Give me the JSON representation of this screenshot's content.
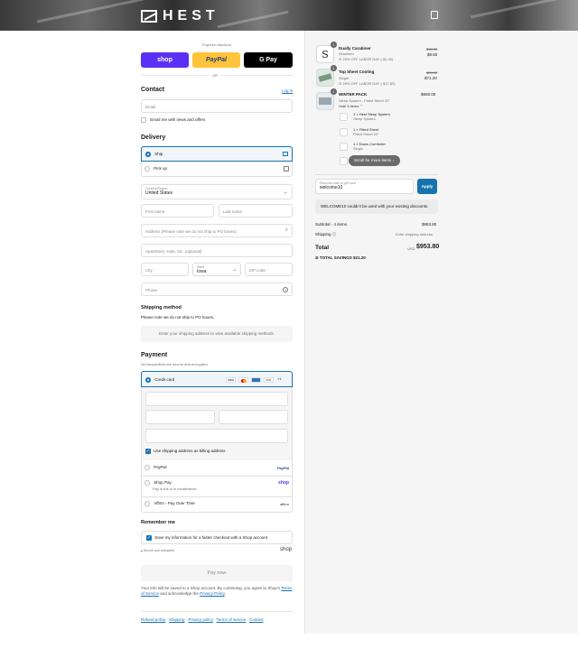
{
  "brand": {
    "name": "HEST"
  },
  "express": {
    "title": "Express checkout",
    "shop": "shop",
    "paypal": "PayPal",
    "gpay": "G Pay",
    "or": "OR"
  },
  "contact": {
    "heading": "Contact",
    "login": "Log in",
    "email_placeholder": "Email",
    "newsletter": "Email me with news and offers"
  },
  "delivery": {
    "heading": "Delivery",
    "ship": "Ship",
    "pickup": "Pick up",
    "country_label": "Country/Region",
    "country_value": "United States",
    "first_name": "First name",
    "last_name": "Last name",
    "address": "Address (Please note we do not ship to PO boxes)",
    "apartment": "Apartment, suite, etc. (optional)",
    "city": "City",
    "state_label": "State",
    "state_value": "Iowa",
    "zip": "ZIP code",
    "phone": "Phone"
  },
  "shipping_method": {
    "heading": "Shipping method",
    "note": "Please note we do not ship to PO boxes.",
    "placeholder": "Enter your shipping address to view available shipping methods."
  },
  "payment": {
    "heading": "Payment",
    "secure_note": "All transactions are secure and encrypted.",
    "credit_card": "Credit card",
    "card_more": "+1",
    "billing_same": "Use shipping address as billing address",
    "paypal": "PayPal",
    "paypal_logo": "PayPal",
    "shop_pay": "Shop Pay",
    "shop_pay_sub": "Pay in full or in installments",
    "shop_pay_logo": "shop",
    "affirm": "Affirm - Pay Over Time",
    "affirm_logo": "affirm"
  },
  "remember": {
    "heading": "Remember me",
    "save": "Save my information for a faster checkout with a Shop account",
    "secure": "Secure and encrypted",
    "shop_logo": "shop"
  },
  "pay_now": "Pay now",
  "legal": {
    "text": "Your info will be saved to a Shop account. By continuing, you agree to Shop's",
    "terms": "Terms of Service",
    "and": "and acknowledge the",
    "privacy": "Privacy Policy",
    "period": "."
  },
  "footer_links": [
    "Refund policy",
    "Shipping",
    "Privacy policy",
    "Terms of service",
    "Contact"
  ],
  "cart": {
    "items": [
      {
        "qty": "1",
        "name": "Dually Carabiner",
        "variant": "Slowburn",
        "discount": "20% OFF LABOR DAY (-$2.40)",
        "compare": "$12.00",
        "price": "$9.60"
      },
      {
        "qty": "1",
        "name": "Top Sheet Cooling",
        "variant": "Single",
        "discount": "20% OFF LABOR DAY (-$17.80)",
        "compare": "$89.00",
        "price": "$71.20"
      },
      {
        "qty": "1",
        "name": "WINTER PACK",
        "variant": "Sleep System - Fitted Sheet 20\"",
        "toggle": "Hide 5 items",
        "compare": "",
        "price": "$869.00"
      }
    ],
    "bundle": [
      {
        "name": "1 × Hest Sleep System",
        "variant": "Sleep System"
      },
      {
        "name": "1 × Fitted Sheet",
        "variant": "Fitted Sheet 20\""
      },
      {
        "name": "1 × Down Comforter",
        "variant": "Single"
      }
    ],
    "scroll_pill": "Scroll for more items",
    "discount_label": "Discount code or gift card",
    "discount_value": "welcome10",
    "apply": "Apply",
    "discount_error": "WELCOME10 couldn't be used with your existing discounts.",
    "subtotal_label": "Subtotal · 4 items",
    "subtotal_value": "$953.80",
    "shipping_label": "Shipping",
    "shipping_value": "Enter shipping address",
    "total_label": "Total",
    "currency": "USD",
    "total_value": "$953.80",
    "savings": "TOTAL SAVINGS  $21.20"
  },
  "colors": {
    "shop": "#5a31f4",
    "paypal": "#ffc439",
    "accent": "#1773b0",
    "apply": "#1773b0"
  }
}
